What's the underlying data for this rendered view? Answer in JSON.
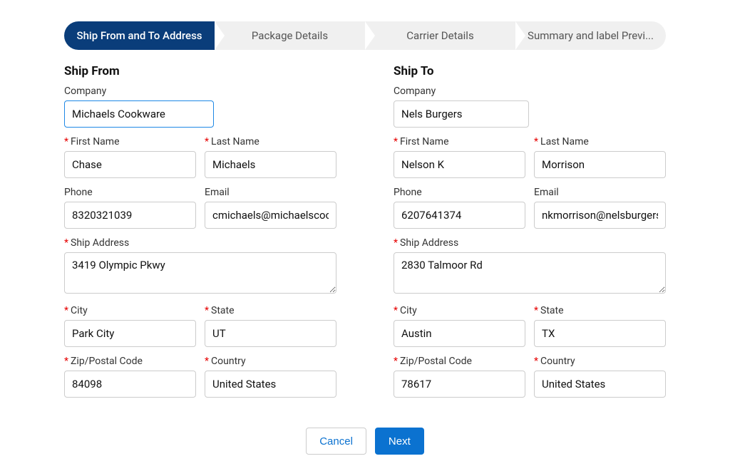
{
  "stepper": {
    "steps": [
      {
        "label": "Ship From and To Address"
      },
      {
        "label": "Package Details"
      },
      {
        "label": "Carrier Details"
      },
      {
        "label": "Summary and label Previ..."
      }
    ]
  },
  "shipFrom": {
    "title": "Ship From",
    "companyLabel": "Company",
    "companyValue": "Michaels Cookware",
    "firstNameLabel": "First Name",
    "firstNameValue": "Chase",
    "lastNameLabel": "Last Name",
    "lastNameValue": "Michaels",
    "phoneLabel": "Phone",
    "phoneValue": "8320321039",
    "emailLabel": "Email",
    "emailValue": "cmichaels@michaelscookware.com",
    "addressLabel": "Ship Address",
    "addressValue": "3419 Olympic Pkwy",
    "cityLabel": "City",
    "cityValue": "Park City",
    "stateLabel": "State",
    "stateValue": "UT",
    "zipLabel": "Zip/Postal Code",
    "zipValue": "84098",
    "countryLabel": "Country",
    "countryValue": "United States"
  },
  "shipTo": {
    "title": "Ship To",
    "companyLabel": "Company",
    "companyValue": "Nels Burgers",
    "firstNameLabel": "First Name",
    "firstNameValue": "Nelson K",
    "lastNameLabel": "Last Name",
    "lastNameValue": "Morrison",
    "phoneLabel": "Phone",
    "phoneValue": "6207641374",
    "emailLabel": "Email",
    "emailValue": "nkmorrison@nelsburgers.com",
    "addressLabel": "Ship Address",
    "addressValue": "2830 Talmoor Rd",
    "cityLabel": "City",
    "cityValue": "Austin",
    "stateLabel": "State",
    "stateValue": "TX",
    "zipLabel": "Zip/Postal Code",
    "zipValue": "78617",
    "countryLabel": "Country",
    "countryValue": "United States"
  },
  "actions": {
    "cancel": "Cancel",
    "next": "Next"
  }
}
